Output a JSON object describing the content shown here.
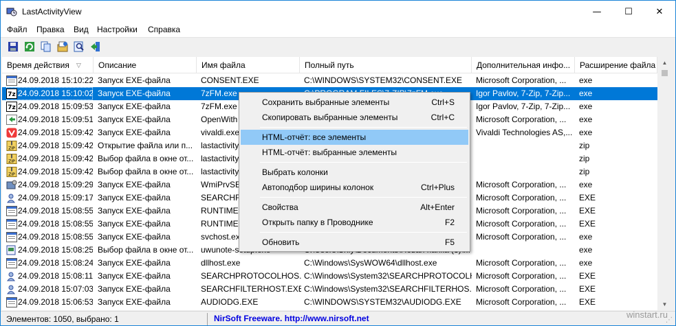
{
  "window": {
    "title": "LastActivityView",
    "min_glyph": "—",
    "max_glyph": "☐",
    "close_glyph": "✕"
  },
  "menu": [
    "Файл",
    "Правка",
    "Вид",
    "Настройки",
    "Справка"
  ],
  "columns": [
    "Время действия",
    "Описание",
    "Имя файла",
    "Полный путь",
    "Дополнительная инфо...",
    "Расширение файла"
  ],
  "rows": [
    {
      "icon": "window-icon",
      "time": "24.09.2018 15:10:22",
      "desc": "Запуск EXE-файла",
      "name": "CONSENT.EXE",
      "path": "C:\\WINDOWS\\SYSTEM32\\CONSENT.EXE",
      "info": "Microsoft Corporation, ...",
      "ext": "exe"
    },
    {
      "icon": "7z-icon",
      "time": "24.09.2018 15:10:02",
      "desc": "Запуск EXE-файла",
      "name": "7zFM.exe",
      "path": "C:\\PROGRAM FILES\\7-ZIP\\7zFM.exe",
      "info": "Igor Pavlov, 7-Zip, 7-Zip...",
      "ext": "exe",
      "selected": true
    },
    {
      "icon": "7z-icon",
      "time": "24.09.2018 15:09:53",
      "desc": "Запуск EXE-файла",
      "name": "7zFM.exe",
      "path": "",
      "info": "Igor Pavlov, 7-Zip, 7-Zip...",
      "ext": "exe"
    },
    {
      "icon": "arrow-icon",
      "time": "24.09.2018 15:09:51",
      "desc": "Запуск EXE-файла",
      "name": "OpenWith",
      "path": "",
      "info": "Microsoft Corporation, ...",
      "ext": "exe"
    },
    {
      "icon": "vivaldi-icon",
      "time": "24.09.2018 15:09:42",
      "desc": "Запуск EXE-файла",
      "name": "vivaldi.exe",
      "path": "",
      "info": "Vivaldi Technologies AS,...",
      "ext": "exe"
    },
    {
      "icon": "zip-icon",
      "time": "24.09.2018 15:09:42",
      "desc": "Открытие файла или п...",
      "name": "lastactivity",
      "path": "",
      "info": "",
      "ext": "zip"
    },
    {
      "icon": "zip-icon",
      "time": "24.09.2018 15:09:42",
      "desc": "Выбор файла в окне от...",
      "name": "lastactivity",
      "path": "",
      "info": "",
      "ext": "zip"
    },
    {
      "icon": "zip-icon",
      "time": "24.09.2018 15:09:42",
      "desc": "Выбор файла в окне от...",
      "name": "lastactivity",
      "path": "",
      "info": "",
      "ext": "zip"
    },
    {
      "icon": "wmi-icon",
      "time": "24.09.2018 15:09:29",
      "desc": "Запуск EXE-файла",
      "name": "WmiPrvSE",
      "path": "",
      "info": "Microsoft Corporation, ...",
      "ext": "exe"
    },
    {
      "icon": "search-user-icon",
      "time": "24.09.2018 15:09:17",
      "desc": "Запуск EXE-файла",
      "name": "SEARCHFI",
      "path": "",
      "info": "Microsoft Corporation, ...",
      "ext": "EXE"
    },
    {
      "icon": "window-icon",
      "time": "24.09.2018 15:08:55",
      "desc": "Запуск EXE-файла",
      "name": "RUNTIMEB",
      "path": "",
      "info": "Microsoft Corporation, ...",
      "ext": "EXE"
    },
    {
      "icon": "window-icon",
      "time": "24.09.2018 15:08:55",
      "desc": "Запуск EXE-файла",
      "name": "RUNTIMEB",
      "path": "",
      "info": "Microsoft Corporation, ...",
      "ext": "EXE"
    },
    {
      "icon": "window-icon",
      "time": "24.09.2018 15:08:55",
      "desc": "Запуск EXE-файла",
      "name": "svchost.ex",
      "path": "",
      "info": "Microsoft Corporation, ...",
      "ext": "exe"
    },
    {
      "icon": "installer-icon",
      "time": "24.09.2018 15:08:25",
      "desc": "Выбор файла в окне от...",
      "name": "uwunote-setup.exe",
      "path": "C:\\Users\\Sniy\\Documents\\Новая папка (3)\\...",
      "info": "",
      "ext": "exe"
    },
    {
      "icon": "window-icon",
      "time": "24.09.2018 15:08:24",
      "desc": "Запуск EXE-файла",
      "name": "dllhost.exe",
      "path": "C:\\Windows\\SysWOW64\\dllhost.exe",
      "info": "Microsoft Corporation, ...",
      "ext": "exe"
    },
    {
      "icon": "search-user-icon",
      "time": "24.09.2018 15:08:11",
      "desc": "Запуск EXE-файла",
      "name": "SEARCHPROTOCOLHOS...",
      "path": "C:\\Windows\\System32\\SEARCHPROTOCOLHO...",
      "info": "Microsoft Corporation, ...",
      "ext": "EXE"
    },
    {
      "icon": "search-user-icon",
      "time": "24.09.2018 15:07:03",
      "desc": "Запуск EXE-файла",
      "name": "SEARCHFILTERHOST.EXE",
      "path": "C:\\Windows\\System32\\SEARCHFILTERHOS...",
      "info": "Microsoft Corporation, ...",
      "ext": "EXE"
    },
    {
      "icon": "window-icon",
      "time": "24.09.2018 15:06:53",
      "desc": "Запуск EXE-файла",
      "name": "AUDIODG.EXE",
      "path": "C:\\WINDOWS\\SYSTEM32\\AUDIODG.EXE",
      "info": "Microsoft Corporation, ...",
      "ext": "EXE"
    }
  ],
  "context_menu": [
    {
      "label": "Сохранить выбранные элементы",
      "key": "Ctrl+S"
    },
    {
      "label": "Скопировать выбранные элементы",
      "key": "Ctrl+C"
    },
    {
      "sep": true
    },
    {
      "label": "HTML-отчёт: все элементы",
      "key": "",
      "highlighted": true
    },
    {
      "label": "HTML-отчёт: выбранные элементы",
      "key": ""
    },
    {
      "sep": true
    },
    {
      "label": "Выбрать колонки",
      "key": ""
    },
    {
      "label": "Автоподбор ширины колонок",
      "key": "Ctrl+Plus"
    },
    {
      "sep": true
    },
    {
      "label": "Свойства",
      "key": "Alt+Enter"
    },
    {
      "label": "Открыть папку в Проводнике",
      "key": "F2"
    },
    {
      "sep": true
    },
    {
      "label": "Обновить",
      "key": "F5"
    }
  ],
  "status": {
    "count": "Элементов: 1050, выбрано: 1",
    "link": "NirSoft Freeware.  http://www.nirsoft.net"
  },
  "watermark": "winstart.ru",
  "colors": {
    "selection": "#0078d7",
    "menu_highlight": "#91c9f7",
    "link": "#0000e0"
  }
}
